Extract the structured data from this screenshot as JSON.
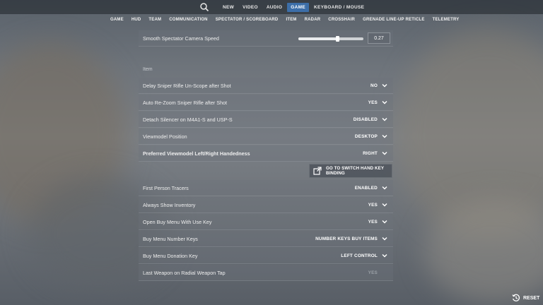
{
  "topnav": {
    "items": [
      {
        "label": "NEW",
        "active": false
      },
      {
        "label": "VIDEO",
        "active": false
      },
      {
        "label": "AUDIO",
        "active": false
      },
      {
        "label": "GAME",
        "active": true
      },
      {
        "label": "KEYBOARD / MOUSE",
        "active": false
      }
    ]
  },
  "subnav": {
    "items": [
      "GAME",
      "HUD",
      "TEAM",
      "COMMUNICATION",
      "SPECTATOR / SCOREBOARD",
      "ITEM",
      "RADAR",
      "CROSSHAIR",
      "GRENADE LINE-UP RETICLE",
      "TELEMETRY"
    ]
  },
  "settings": {
    "camera_speed": {
      "label": "Smooth Spectator Camera Speed",
      "value": "0.27",
      "fraction": 0.27
    },
    "section_title": "Item",
    "rows": [
      {
        "label": "Delay Sniper Rifle Un-Scope after Shot",
        "value": "NO"
      },
      {
        "label": "Auto Re-Zoom Sniper Rifle after Shot",
        "value": "YES"
      },
      {
        "label": "Detach Silencer on M4A1-S and USP-S",
        "value": "DISABLED"
      },
      {
        "label": "Viewmodel Position",
        "value": "DESKTOP"
      },
      {
        "label": "Preferred Viewmodel Left/Right Handedness",
        "value": "RIGHT"
      },
      {
        "label": "First Person Tracers",
        "value": "ENABLED"
      },
      {
        "label": "Always Show Inventory",
        "value": "YES"
      },
      {
        "label": "Open Buy Menu With Use Key",
        "value": "YES"
      },
      {
        "label": "Buy Menu Number Keys",
        "value": "NUMBER KEYS BUY ITEMS"
      },
      {
        "label": "Buy Menu Donation Key",
        "value": "LEFT CONTROL"
      },
      {
        "label": "Last Weapon on Radial Weapon Tap",
        "value": "YES"
      }
    ],
    "keybind_button": "GO TO SWITCH HAND KEY BINDING"
  },
  "footer": {
    "reset_label": "RESET"
  },
  "icons": {
    "search": "search-icon",
    "chevron": "chevron-down-icon",
    "external": "external-link-icon",
    "reset": "reset-clock-icon"
  }
}
